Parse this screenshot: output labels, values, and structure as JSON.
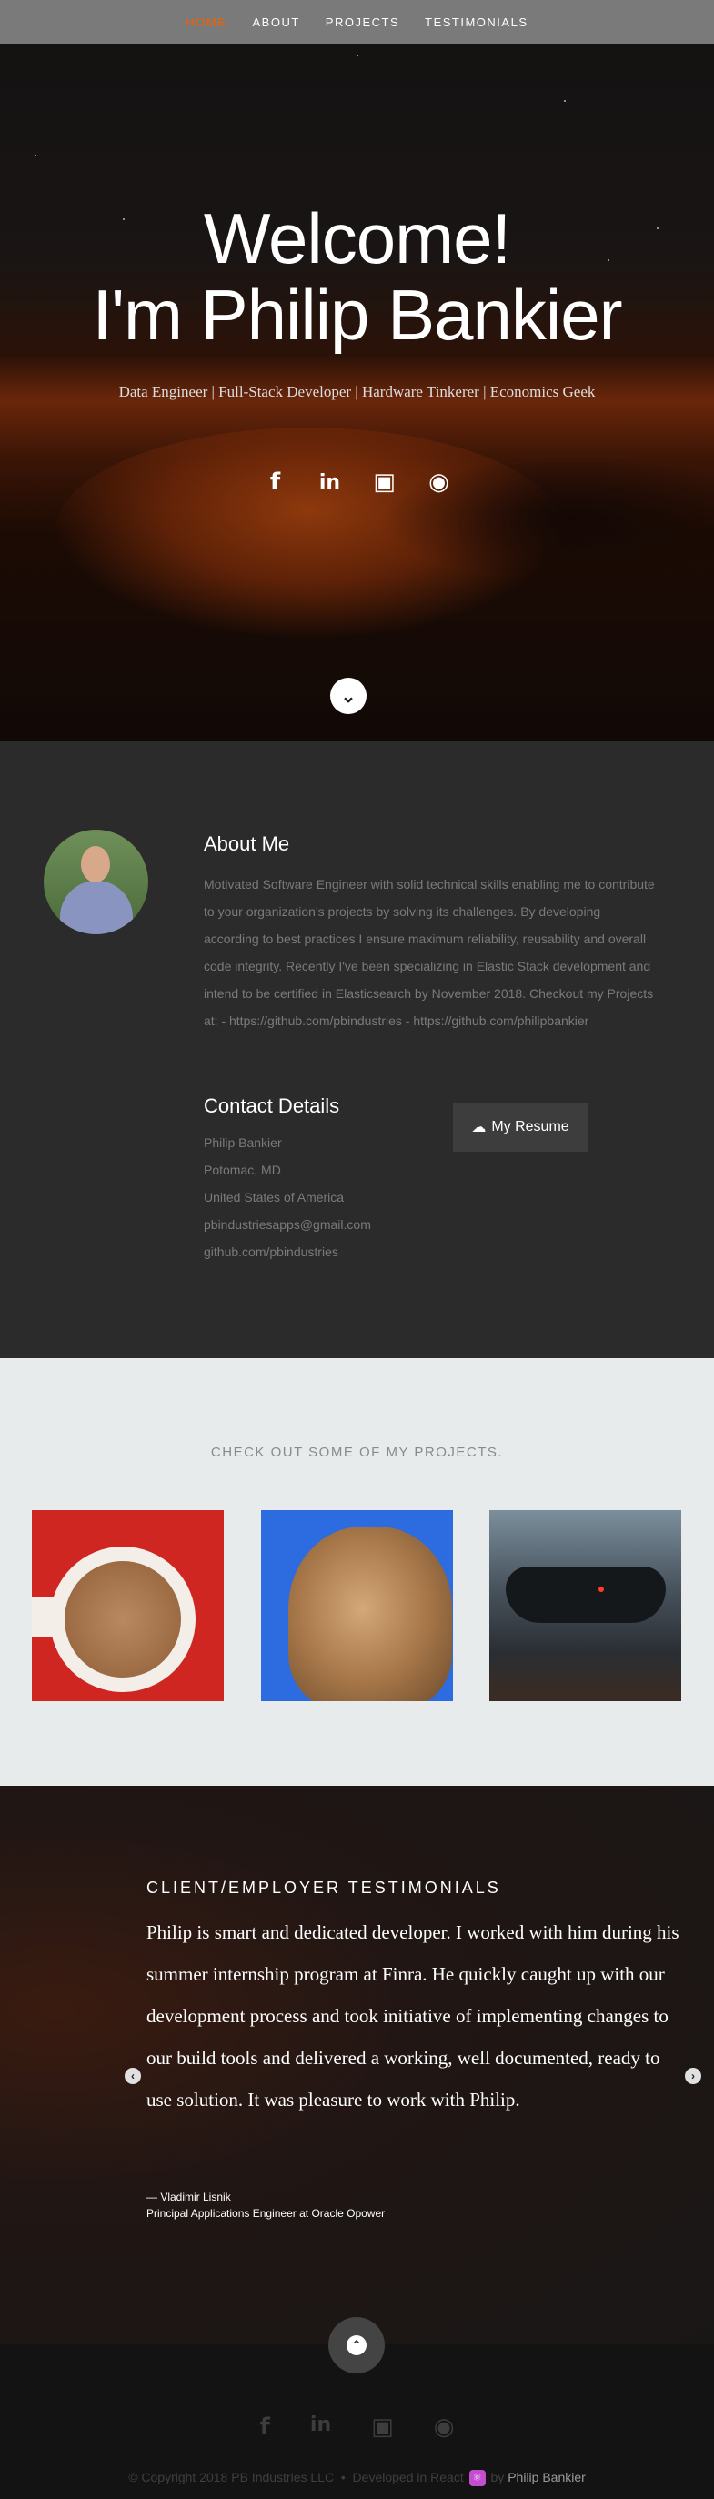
{
  "nav": {
    "items": [
      {
        "label": "HOME",
        "active": true
      },
      {
        "label": "ABOUT"
      },
      {
        "label": "PROJECTS"
      },
      {
        "label": "TESTIMONIALS"
      }
    ],
    "active_color": "#f06000"
  },
  "hero": {
    "title_line1": "Welcome!",
    "title_line2": "I'm Philip Bankier",
    "subtitle": "Data Engineer | Full-Stack Developer | Hardware Tinkerer | Economics Geek",
    "social_icons": [
      "facebook-icon",
      "linkedin-icon",
      "instagram-icon",
      "github-icon"
    ]
  },
  "about": {
    "heading": "About Me",
    "bio": "Motivated Software Engineer with solid technical skills enabling me to contribute to your organization's projects by solving its challenges. By developing according to best practices I ensure maximum reliability, reusability and overall code integrity. Recently I've been specializing in Elastic Stack development and intend to be certified in Elasticsearch by November 2018. Checkout my Projects at: - https://github.com/pbindustries - https://github.com/philipbankier",
    "contact_heading": "Contact Details",
    "contact": {
      "name": "Philip Bankier",
      "city": "Potomac, MD",
      "country": "United States of America",
      "email": "pbindustriesapps@gmail.com",
      "github": "github.com/pbindustries"
    },
    "resume_label": "My Resume"
  },
  "projects": {
    "heading": "CHECK OUT SOME OF MY PROJECTS."
  },
  "testimonials": {
    "heading": "CLIENT/EMPLOYER TESTIMONIALS",
    "quote": "Philip is smart and dedicated developer. I worked with him during his summer internship program at Finra. He quickly caught up with our development process and took initiative of implementing changes to our build tools and delivered a working, well documented, ready to use solution. It was pleasure to work with Philip.",
    "author": "— Vladimir Lisnik",
    "role": "Principal Applications Engineer at Oracle Opower"
  },
  "footer": {
    "copyright": "© Copyright 2018 PB Industries LLC",
    "separator": "•",
    "developed_prefix": "Developed in React",
    "by": "by",
    "name": "Philip Bankier"
  }
}
